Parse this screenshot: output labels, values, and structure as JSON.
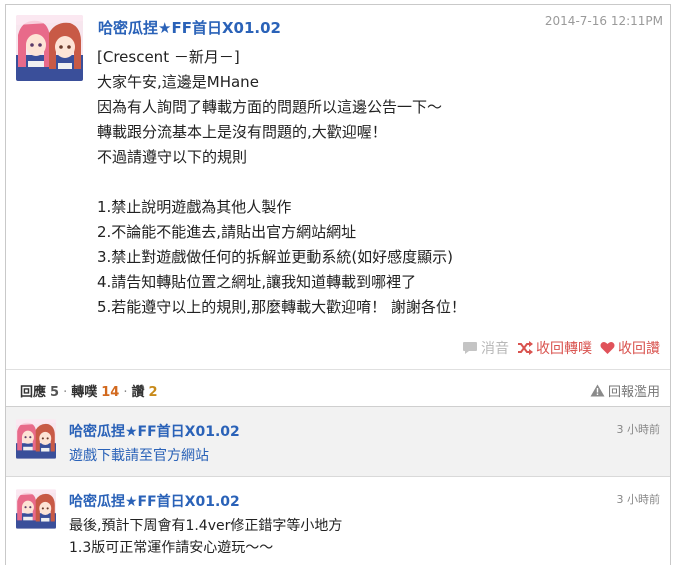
{
  "post": {
    "author": "哈密瓜捏★FF首日X01.02",
    "time": "2014-7-16 12:11PM",
    "lines": [
      "[Crescent －新月－]",
      "大家午安,這邊是MHane",
      "因為有人詢問了轉載方面的問題所以這邊公告一下～",
      "轉載跟分流基本上是沒有問題的,大歡迎喔！",
      "不過請遵守以下的規則",
      "",
      "1.禁止說明遊戲為其他人製作",
      "2.不論能不能進去,請貼出官方網站網址",
      "3.禁止對遊戲做任何的拆解並更動系統(如好感度顯示)",
      "4.請告知轉貼位置之網址,讓我知道轉載到哪裡了",
      "5.若能遵守以上的規則,那麼轉載大歡迎唷！ 謝謝各位！"
    ],
    "actions": {
      "mute": "消音",
      "retweet": "收回轉噗",
      "unfav": "收回讚"
    }
  },
  "stats": {
    "reply_label": "回應",
    "reply_count": "5",
    "retweet_label": "轉噗",
    "retweet_count": "14",
    "fav_label": "讚",
    "fav_count": "2",
    "sep": "·",
    "report": "回報濫用"
  },
  "replies": [
    {
      "author": "哈密瓜捏★FF首日X01.02",
      "time": "3 小時前",
      "lines": [
        "遊戲下載請至官方網站"
      ]
    },
    {
      "author": "哈密瓜捏★FF首日X01.02",
      "time": "3 小時前",
      "lines": [
        "最後,預計下周會有1.4ver修正錯字等小地方",
        "1.3版可正常運作請安心遊玩～～"
      ]
    }
  ],
  "colors": {
    "link": "#2a62b8",
    "accent_red": "#d9534f",
    "retweet_count": "#d2691e",
    "fav_count": "#c88a1a"
  },
  "icons": {
    "mute": "speech-bubble-icon",
    "retweet": "shuffle-icon",
    "unfav": "heart-icon",
    "report": "warning-triangle-icon"
  }
}
